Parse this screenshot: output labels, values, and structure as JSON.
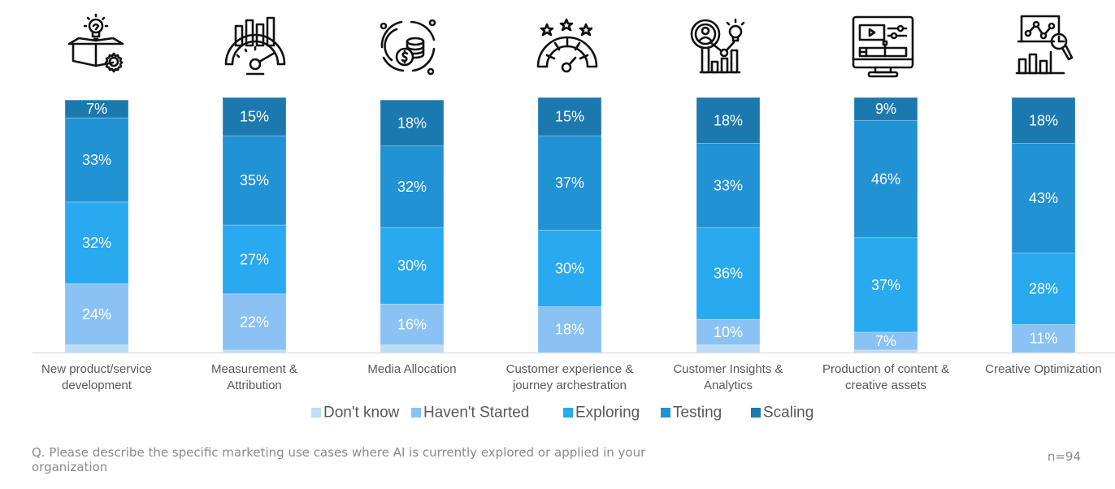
{
  "chart_data": {
    "type": "bar",
    "stacked": true,
    "title": "",
    "xlabel": "",
    "ylabel": "",
    "ylim": [
      0,
      100
    ],
    "grid": false,
    "legend_position": "bottom",
    "categories": [
      [
        "New product/service",
        "development"
      ],
      [
        "Measurement &",
        "Attribution"
      ],
      [
        "Media Allocation"
      ],
      [
        "Customer experience &",
        "journey archestration"
      ],
      [
        "Customer Insights &",
        "Analytics"
      ],
      [
        "Production of content &",
        "creative assets"
      ],
      [
        "Creative Optimization"
      ]
    ],
    "category_icons": [
      "product-box-lightbulb-gear-icon",
      "speedometer-bar-chart-icon",
      "coins-cycle-icon",
      "rating-gauge-stars-icon",
      "magnifier-user-lightbulb-icon",
      "monitor-video-editor-icon",
      "laptop-analytics-magnifier-icon"
    ],
    "series": [
      {
        "name": "Don't know",
        "color": "#BDDCF6",
        "values": [
          3,
          1,
          3,
          0,
          3,
          1,
          0
        ],
        "show_labels": false
      },
      {
        "name": "Haven't Started",
        "color": "#8AC2F4",
        "values": [
          24,
          22,
          16,
          18,
          10,
          7,
          11
        ],
        "show_labels": true
      },
      {
        "name": "Exploring",
        "color": "#29A9EF",
        "values": [
          32,
          27,
          30,
          30,
          36,
          37,
          28
        ],
        "show_labels": true
      },
      {
        "name": "Testing",
        "color": "#2192D3",
        "values": [
          33,
          35,
          32,
          37,
          33,
          46,
          43
        ],
        "show_labels": true
      },
      {
        "name": "Scaling",
        "color": "#1C79B0",
        "values": [
          7,
          15,
          18,
          15,
          18,
          9,
          18
        ],
        "show_labels": true
      }
    ]
  },
  "footnote": {
    "question": "Q. Please describe the specific marketing use cases where AI is currently explored or applied in your organization",
    "sample_size": "n=94"
  }
}
